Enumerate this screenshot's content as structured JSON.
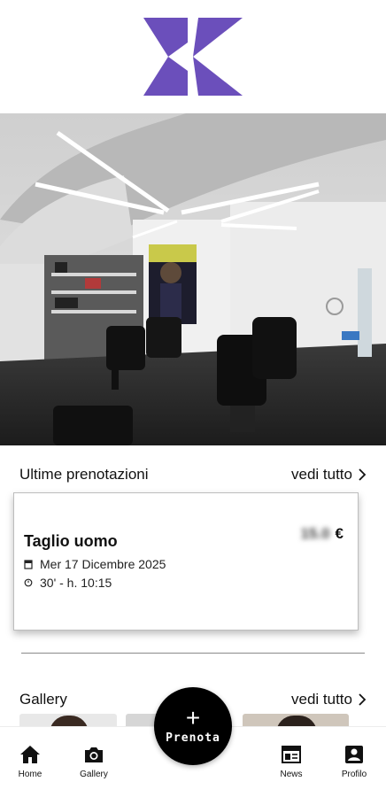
{
  "brand": {
    "logo_icon": "k-logo-icon",
    "accent": "#6b4fbb"
  },
  "hero": {
    "image_icon": "barbershop-interior-photo"
  },
  "bookings": {
    "title": "Ultime prenotazioni",
    "see_all": "vedi tutto",
    "card": {
      "service": "Taglio uomo",
      "price": "15.0",
      "currency": "€",
      "date": "Mer 17 Dicembre 2025",
      "time": "30' - h. 10:15",
      "date_icon": "calendar-icon",
      "time_icon": "clock-icon"
    }
  },
  "gallery": {
    "title": "Gallery",
    "see_all": "vedi tutto"
  },
  "fab": {
    "plus": "+",
    "label": "Prenota"
  },
  "nav": {
    "home": "Home",
    "gallery": "Gallery",
    "news": "News",
    "profile": "Profilo"
  }
}
